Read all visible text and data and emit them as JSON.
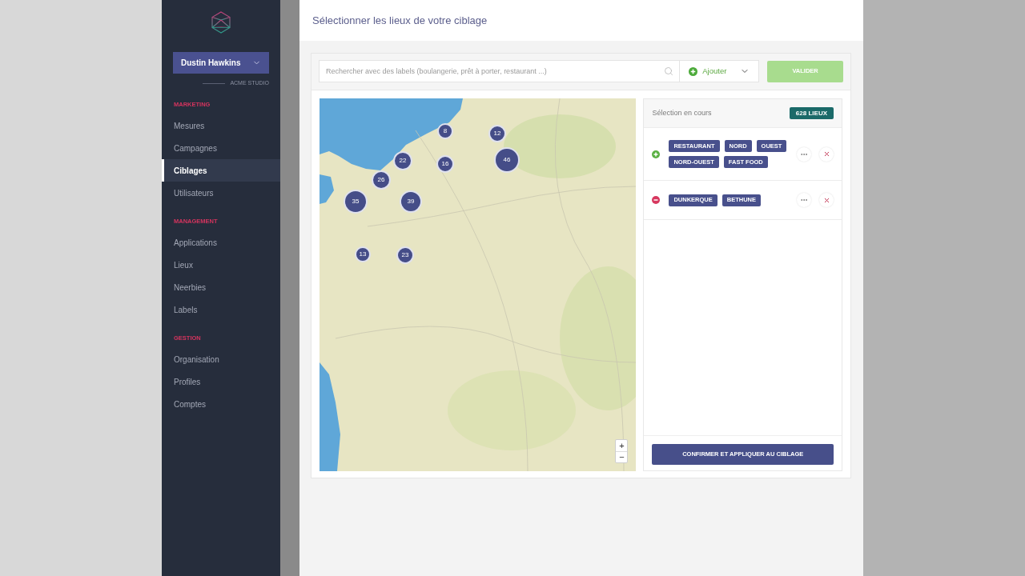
{
  "sidebar": {
    "user": "Dustin Hawkins",
    "organization": "ACME STUDIO",
    "sections": [
      {
        "title": "MARKETING",
        "items": [
          {
            "label": "Mesures",
            "selected": false
          },
          {
            "label": "Campagnes",
            "selected": false
          },
          {
            "label": "Ciblages",
            "selected": true
          },
          {
            "label": "Utilisateurs",
            "selected": false
          }
        ]
      },
      {
        "title": "MANAGEMENT",
        "items": [
          {
            "label": "Applications",
            "selected": false
          },
          {
            "label": "Lieux",
            "selected": false
          },
          {
            "label": "Neerbies",
            "selected": false
          },
          {
            "label": "Labels",
            "selected": false
          }
        ]
      },
      {
        "title": "GESTION",
        "items": [
          {
            "label": "Organisation",
            "selected": false
          },
          {
            "label": "Profiles",
            "selected": false
          },
          {
            "label": "Comptes",
            "selected": false
          }
        ]
      }
    ]
  },
  "header": {
    "title": "Sélectionner les lieux de votre ciblage"
  },
  "toolbar": {
    "search": {
      "placeholder": "Rechercher avec des labels (boulangerie, prêt à porter, restaurant ...)"
    },
    "add_dropdown": {
      "label": "Ajouter"
    },
    "validate_button": {
      "label": "VALIDER"
    }
  },
  "map": {
    "clusters": [
      {
        "count": "8"
      },
      {
        "count": "12"
      },
      {
        "count": "22"
      },
      {
        "count": "16"
      },
      {
        "count": "46"
      },
      {
        "count": "26"
      },
      {
        "count": "35"
      },
      {
        "count": "39"
      },
      {
        "count": "13"
      },
      {
        "count": "23"
      }
    ],
    "zoom_controls": [
      "+",
      "−"
    ]
  },
  "selection": {
    "title": "Sélection en cours",
    "count_badge": "628 LIEUX",
    "rules": [
      {
        "kind": "include",
        "tags": [
          "RESTAURANT",
          "NORD",
          "OUEST",
          "NORD-OUEST",
          "FAST FOOD"
        ]
      },
      {
        "kind": "exclude",
        "tags": [
          "DUNKERQUE",
          "BETHUNE"
        ]
      }
    ],
    "confirm_button": {
      "label": "CONFIRMER ET APPLIQUER AU CIBLAGE"
    }
  }
}
